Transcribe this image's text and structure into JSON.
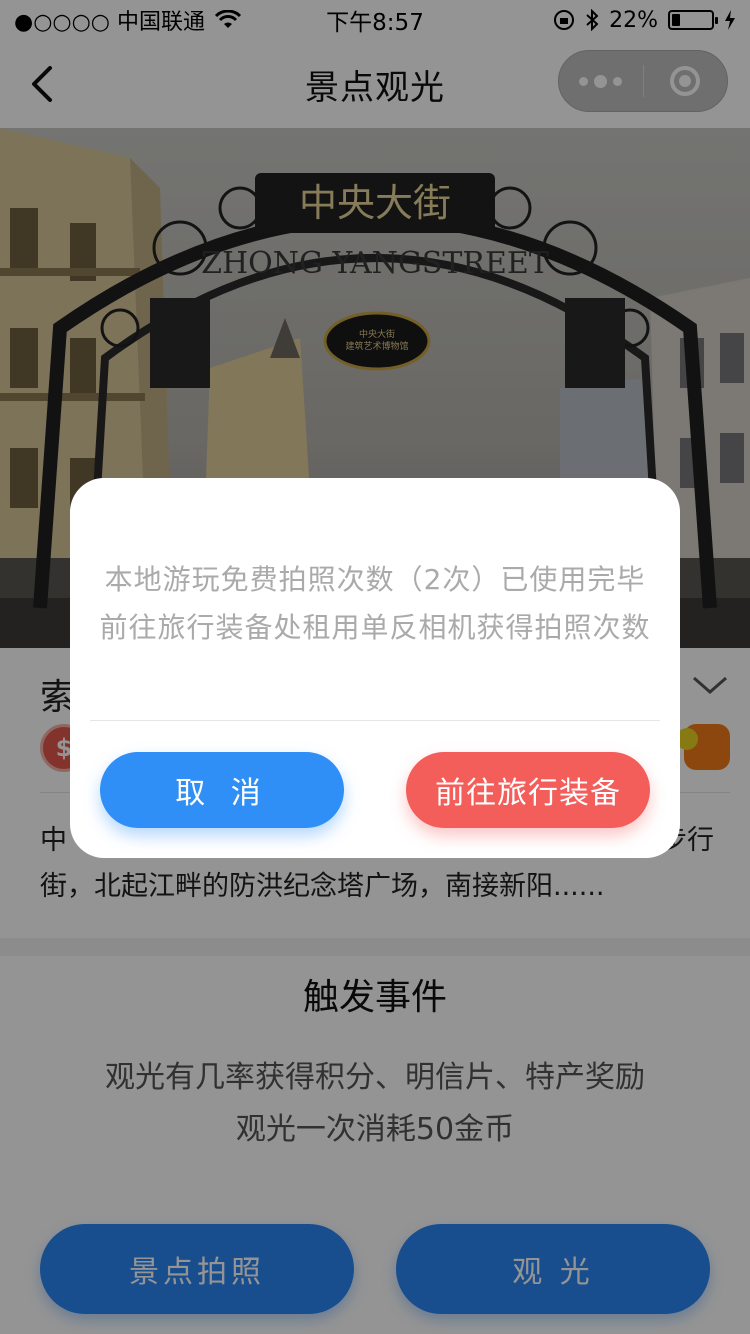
{
  "status_bar": {
    "carrier": "●○○○○ 中国联通",
    "time": "下午8:57",
    "battery": "22%",
    "battery_level": 0.22
  },
  "nav": {
    "title": "景点观光"
  },
  "hero": {
    "sign_cn": "中央大街",
    "sign_en": "ZHONG YANGSTREET",
    "plaque_line1": "中央大街",
    "plaque_line2": "建筑艺术博物馆"
  },
  "spot": {
    "name_partial": "索",
    "badge_symbol": "$",
    "description": "中央大街……步行街，北起江畔的防洪纪念塔广场，南接新阳……",
    "description_visible_start": "中",
    "description_visible_end": "步行",
    "description_line2": "街，北起江畔的防洪纪念塔广场，南接新阳......"
  },
  "events": {
    "title": "触发事件",
    "line1": "观光有几率获得积分、明信片、特产奖励",
    "line2": "观光一次消耗50金币"
  },
  "actions": {
    "photo_label": "景点拍照",
    "sightseeing_label": "观 光"
  },
  "modal": {
    "message_line1": "本地游玩免费拍照次数（2次）已使用完毕",
    "message_line2": "前往旅行装备处租用单反相机获得拍照次数",
    "cancel_label": "取 消",
    "confirm_label": "前往旅行装备"
  },
  "colors": {
    "primary_blue": "#2a86f5",
    "confirm_red": "#f35e5b",
    "overlay": "rgba(0,0,0,0.42)"
  }
}
